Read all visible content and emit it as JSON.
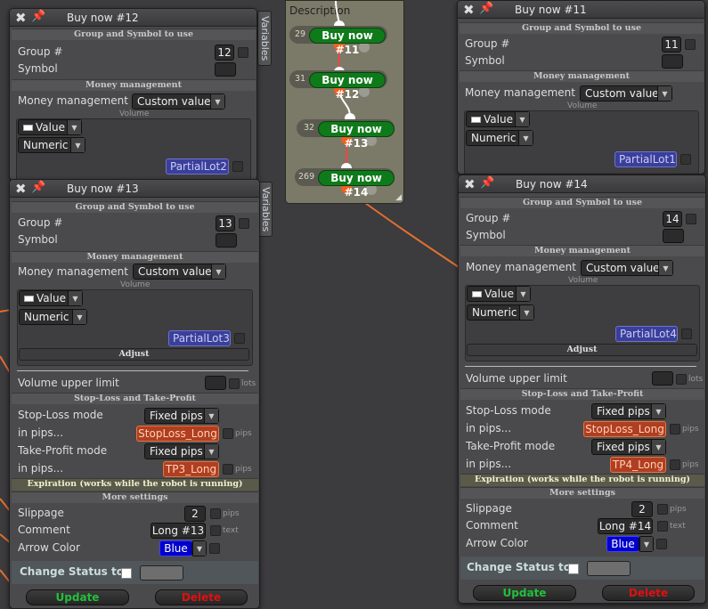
{
  "flow": {
    "description_label": "Description",
    "nodes": [
      {
        "num": "29",
        "label": "Buy now #11"
      },
      {
        "num": "31",
        "label": "Buy now #12"
      },
      {
        "num": "32",
        "label": "Buy now #13"
      },
      {
        "num": "269",
        "label": "Buy now #14"
      }
    ]
  },
  "side_tab_label": "Variables",
  "panels": {
    "p12": {
      "title": "Buy now #12",
      "sec_group": "Group and Symbol to use",
      "group_label": "Group #",
      "group_value": "12",
      "symbol_label": "Symbol",
      "sec_money": "Money management",
      "mm_label": "Money management",
      "mm_value": "Custom value",
      "volume_label": "Volume",
      "value_label": "Value",
      "numeric_label": "Numeric",
      "lot_var": "PartialLot2"
    },
    "p11": {
      "title": "Buy now #11",
      "sec_group": "Group and Symbol to use",
      "group_label": "Group #",
      "group_value": "11",
      "symbol_label": "Symbol",
      "sec_money": "Money management",
      "mm_label": "Money management",
      "mm_value": "Custom value",
      "volume_label": "Volume",
      "value_label": "Value",
      "numeric_label": "Numeric",
      "lot_var": "PartialLot1"
    },
    "p13": {
      "title": "Buy now #13",
      "sec_group": "Group and Symbol to use",
      "group_label": "Group #",
      "group_value": "13",
      "symbol_label": "Symbol",
      "sec_money": "Money management",
      "mm_label": "Money management",
      "mm_value": "Custom value",
      "volume_label": "Volume",
      "value_label": "Value",
      "numeric_label": "Numeric",
      "lot_var": "PartialLot3",
      "adjust_label": "Adjust",
      "vul_label": "Volume upper limit",
      "lots_unit": "lots",
      "sec_sltp": "Stop-Loss and Take-Profit",
      "sl_mode_label": "Stop-Loss mode",
      "sl_mode_value": "Fixed pips",
      "in_pips_label": "in pips...",
      "sl_var": "StopLoss_Long",
      "pips_unit": "pips",
      "tp_mode_label": "Take-Profit mode",
      "tp_mode_value": "Fixed pips",
      "tp_var": "TP3_Long",
      "sec_exp": "Expiration (works while the robot is running)",
      "sec_more": "More settings",
      "slippage_label": "Slippage",
      "slippage_value": "2",
      "comment_label": "Comment",
      "comment_value": "Long #13",
      "text_unit": "text",
      "arrow_label": "Arrow Color",
      "arrow_value": "Blue",
      "status_label": "Change Status to",
      "update_label": "Update",
      "delete_label": "Delete"
    },
    "p14": {
      "title": "Buy now #14",
      "sec_group": "Group and Symbol to use",
      "group_label": "Group #",
      "group_value": "14",
      "symbol_label": "Symbol",
      "sec_money": "Money management",
      "mm_label": "Money management",
      "mm_value": "Custom value",
      "volume_label": "Volume",
      "value_label": "Value",
      "numeric_label": "Numeric",
      "lot_var": "PartialLot4",
      "adjust_label": "Adjust",
      "vul_label": "Volume upper limit",
      "lots_unit": "lots",
      "sec_sltp": "Stop-Loss and Take-Profit",
      "sl_mode_label": "Stop-Loss mode",
      "sl_mode_value": "Fixed pips",
      "in_pips_label": "in pips...",
      "sl_var": "StopLoss_Long",
      "pips_unit": "pips",
      "tp_mode_label": "Take-Profit mode",
      "tp_mode_value": "Fixed pips",
      "tp_var": "TP4_Long",
      "sec_exp": "Expiration (works while the robot is running)",
      "sec_more": "More settings",
      "slippage_label": "Slippage",
      "slippage_value": "2",
      "comment_label": "Comment",
      "comment_value": "Long #14",
      "text_unit": "text",
      "arrow_label": "Arrow Color",
      "arrow_value": "Blue",
      "status_label": "Change Status to",
      "update_label": "Update",
      "delete_label": "Delete"
    }
  },
  "colors": {
    "update": "#22c03a",
    "delete": "#e01010",
    "wire": "#e07030",
    "node": "#0f7a1a"
  }
}
